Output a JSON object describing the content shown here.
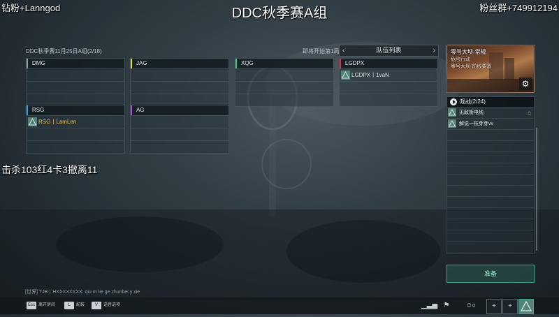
{
  "overlay": {
    "top_left": "钻粉+Lanngod",
    "top_right": "粉丝群+749912194",
    "title": "DDC秋季赛A组",
    "kill_stats": "击杀103红4卡3撤离11"
  },
  "header": {
    "match_info": "DDC秋季赛11月25日A组(2/18)",
    "countdown": "即将开始第1局"
  },
  "teams": [
    {
      "name": "DMG",
      "color": "#9aa4aa",
      "members": []
    },
    {
      "name": "JAG",
      "color": "#e6e23a",
      "members": []
    },
    {
      "name": "XQG",
      "color": "#3fd17a",
      "members": []
    },
    {
      "name": "LGDPX",
      "color": "#e0304a",
      "members": [
        "LGDPX丨1vaN"
      ]
    },
    {
      "name": "RSG",
      "color": "#3aa3e6",
      "members": [
        "RSG丨LamLen"
      ]
    },
    {
      "name": "AG",
      "color": "#b04ee0",
      "members": []
    }
  ],
  "roster": {
    "title": "队伍列表",
    "prev_icon": "chevron-left-icon",
    "next_icon": "chevron-right-icon"
  },
  "game_card": {
    "title": "零号大坝-常规",
    "mode": "危险行动",
    "map": "零号大坝-前线要塞"
  },
  "spectators": {
    "header": "观战(2/24)",
    "list": [
      {
        "name": "无敌街电线",
        "host": true
      },
      {
        "name": "解说一枝芽芽vv",
        "host": false
      }
    ]
  },
  "ready_button": "准备",
  "chat": "[世界] TJB丨HXXXXXXXX: qiu m lie ge zhunbei y xie",
  "bottom_bar": {
    "hints": [
      {
        "key": "Esc",
        "label": "离开房间"
      },
      {
        "key": "L",
        "label": "配装"
      },
      {
        "key": "V",
        "label": "语音选项"
      }
    ],
    "player_count": "0"
  },
  "colors": {
    "accent": "#3fa58d",
    "member_icon": "#57827a"
  }
}
